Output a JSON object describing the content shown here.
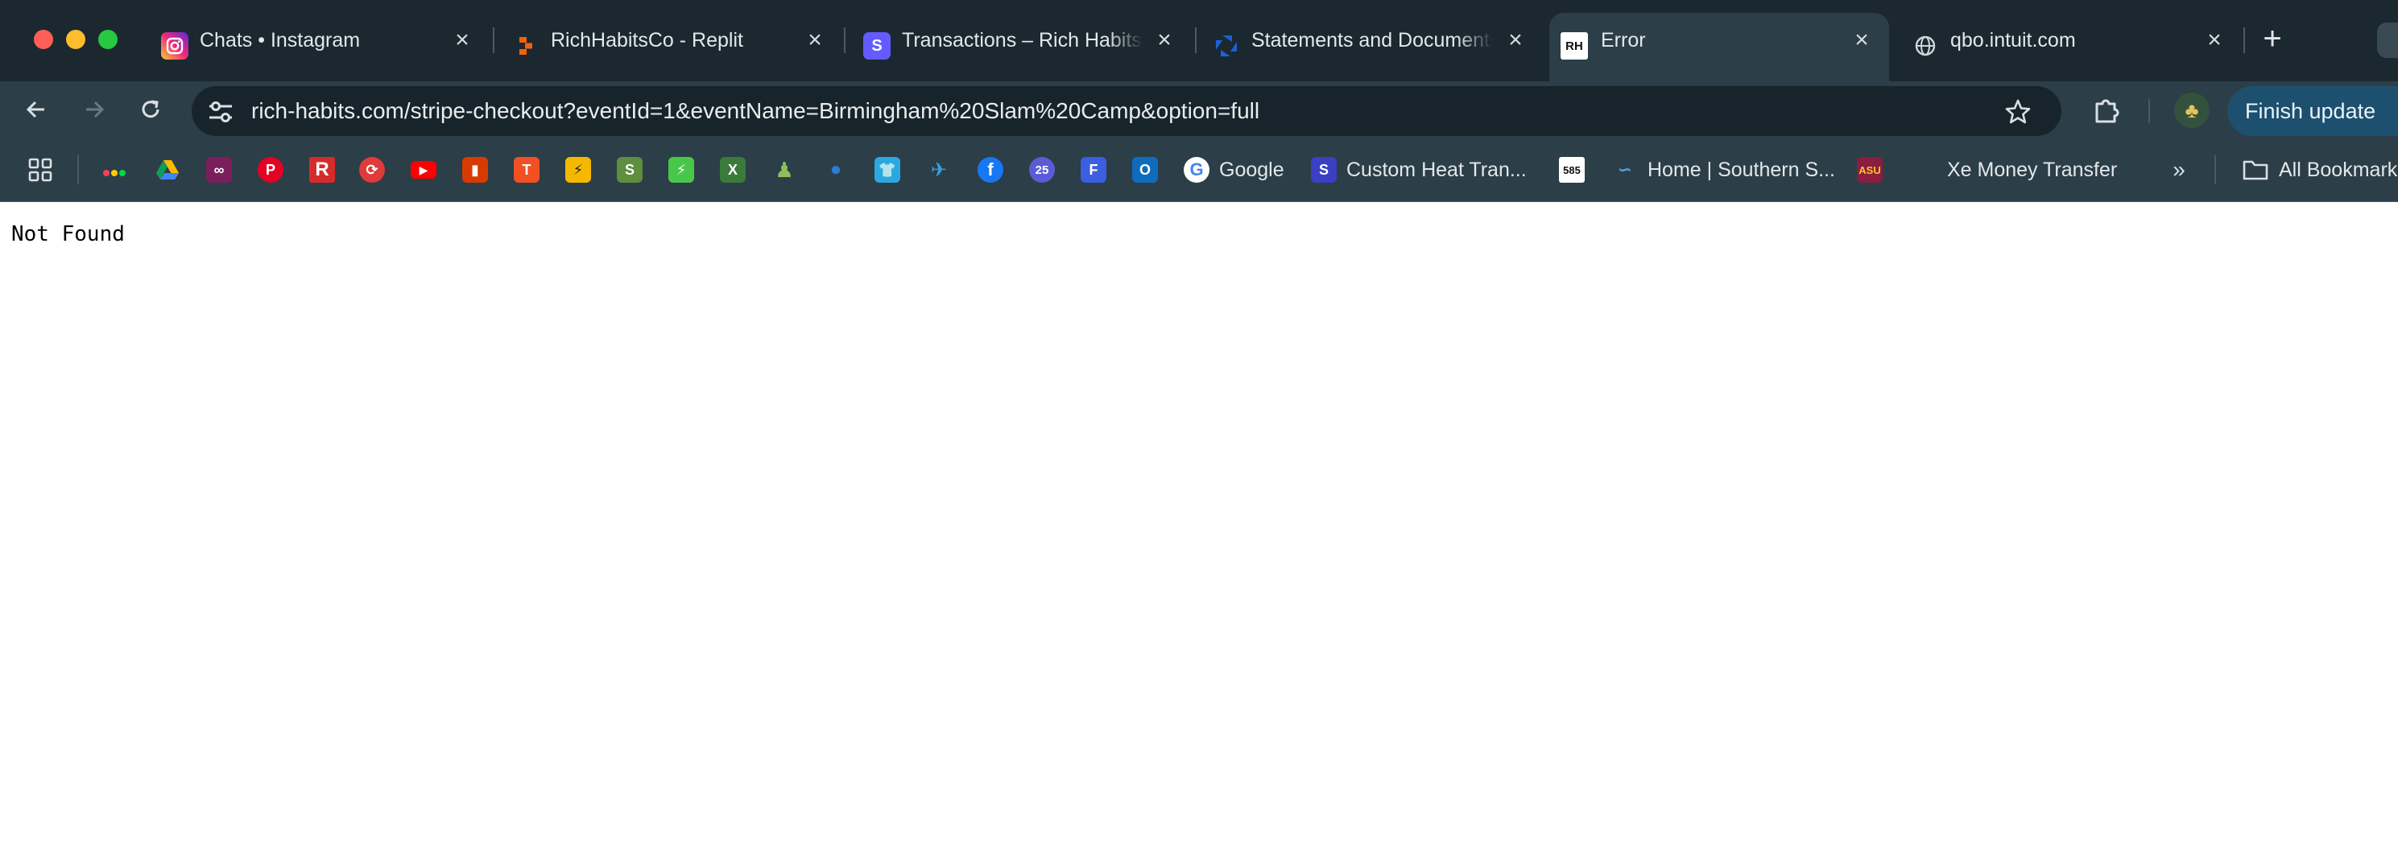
{
  "tabs": [
    {
      "title": "Chats • Instagram",
      "icon": "instagram-icon"
    },
    {
      "title": "RichHabitsCo - Replit",
      "icon": "replit-icon"
    },
    {
      "title": "Transactions – Rich Habits",
      "icon": "stripe-icon"
    },
    {
      "title": "Statements and Documents",
      "icon": "chase-icon"
    },
    {
      "title": "Error",
      "icon": "rich-habits-icon",
      "active": true
    },
    {
      "title": "qbo.intuit.com",
      "icon": "globe-icon"
    }
  ],
  "toolbar": {
    "url": "rich-habits.com/stripe-checkout?eventId=1&eventName=Birmingham%20Slam%20Camp&option=full",
    "finish_update": "Finish update"
  },
  "bookmarks": {
    "google": "Google",
    "custom_heat": "Custom Heat Tran...",
    "home_southern": "Home | Southern S...",
    "xe": "Xe Money Transfer",
    "all_bookmarks": "All Bookmarks",
    "calendar_day": "25",
    "s85": "585"
  },
  "page": {
    "message": "Not Found"
  },
  "colors": {
    "tabstrip": "#1b2830",
    "toolbar": "#2c3e48",
    "omnibox": "#18242b",
    "finish_button": "#1d4f6e"
  }
}
